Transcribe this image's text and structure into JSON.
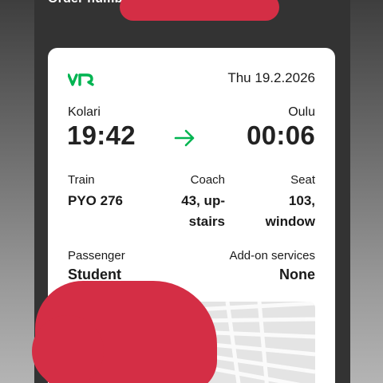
{
  "header": {
    "order_label": "Order numb"
  },
  "ticket": {
    "date": "Thu 19.2.2026",
    "from": {
      "city": "Kolari",
      "time": "19:42"
    },
    "to": {
      "city": "Oulu",
      "time": "00:06"
    },
    "train": {
      "label": "Train",
      "value": "PYO 276"
    },
    "coach": {
      "label": "Coach",
      "line1": "43, up-",
      "line2": "stairs"
    },
    "seat": {
      "label": "Seat",
      "line1": "103,",
      "line2": "window"
    },
    "passenger": {
      "label": "Passenger",
      "value": "Student"
    },
    "addons": {
      "label": "Add-on services",
      "value": "None"
    }
  },
  "colors": {
    "accent": "#00b451",
    "redaction": "#d42e45",
    "dark_bg": "#333333"
  },
  "icons": {
    "logo": "vr-logo",
    "direction": "arrow-right-icon"
  }
}
